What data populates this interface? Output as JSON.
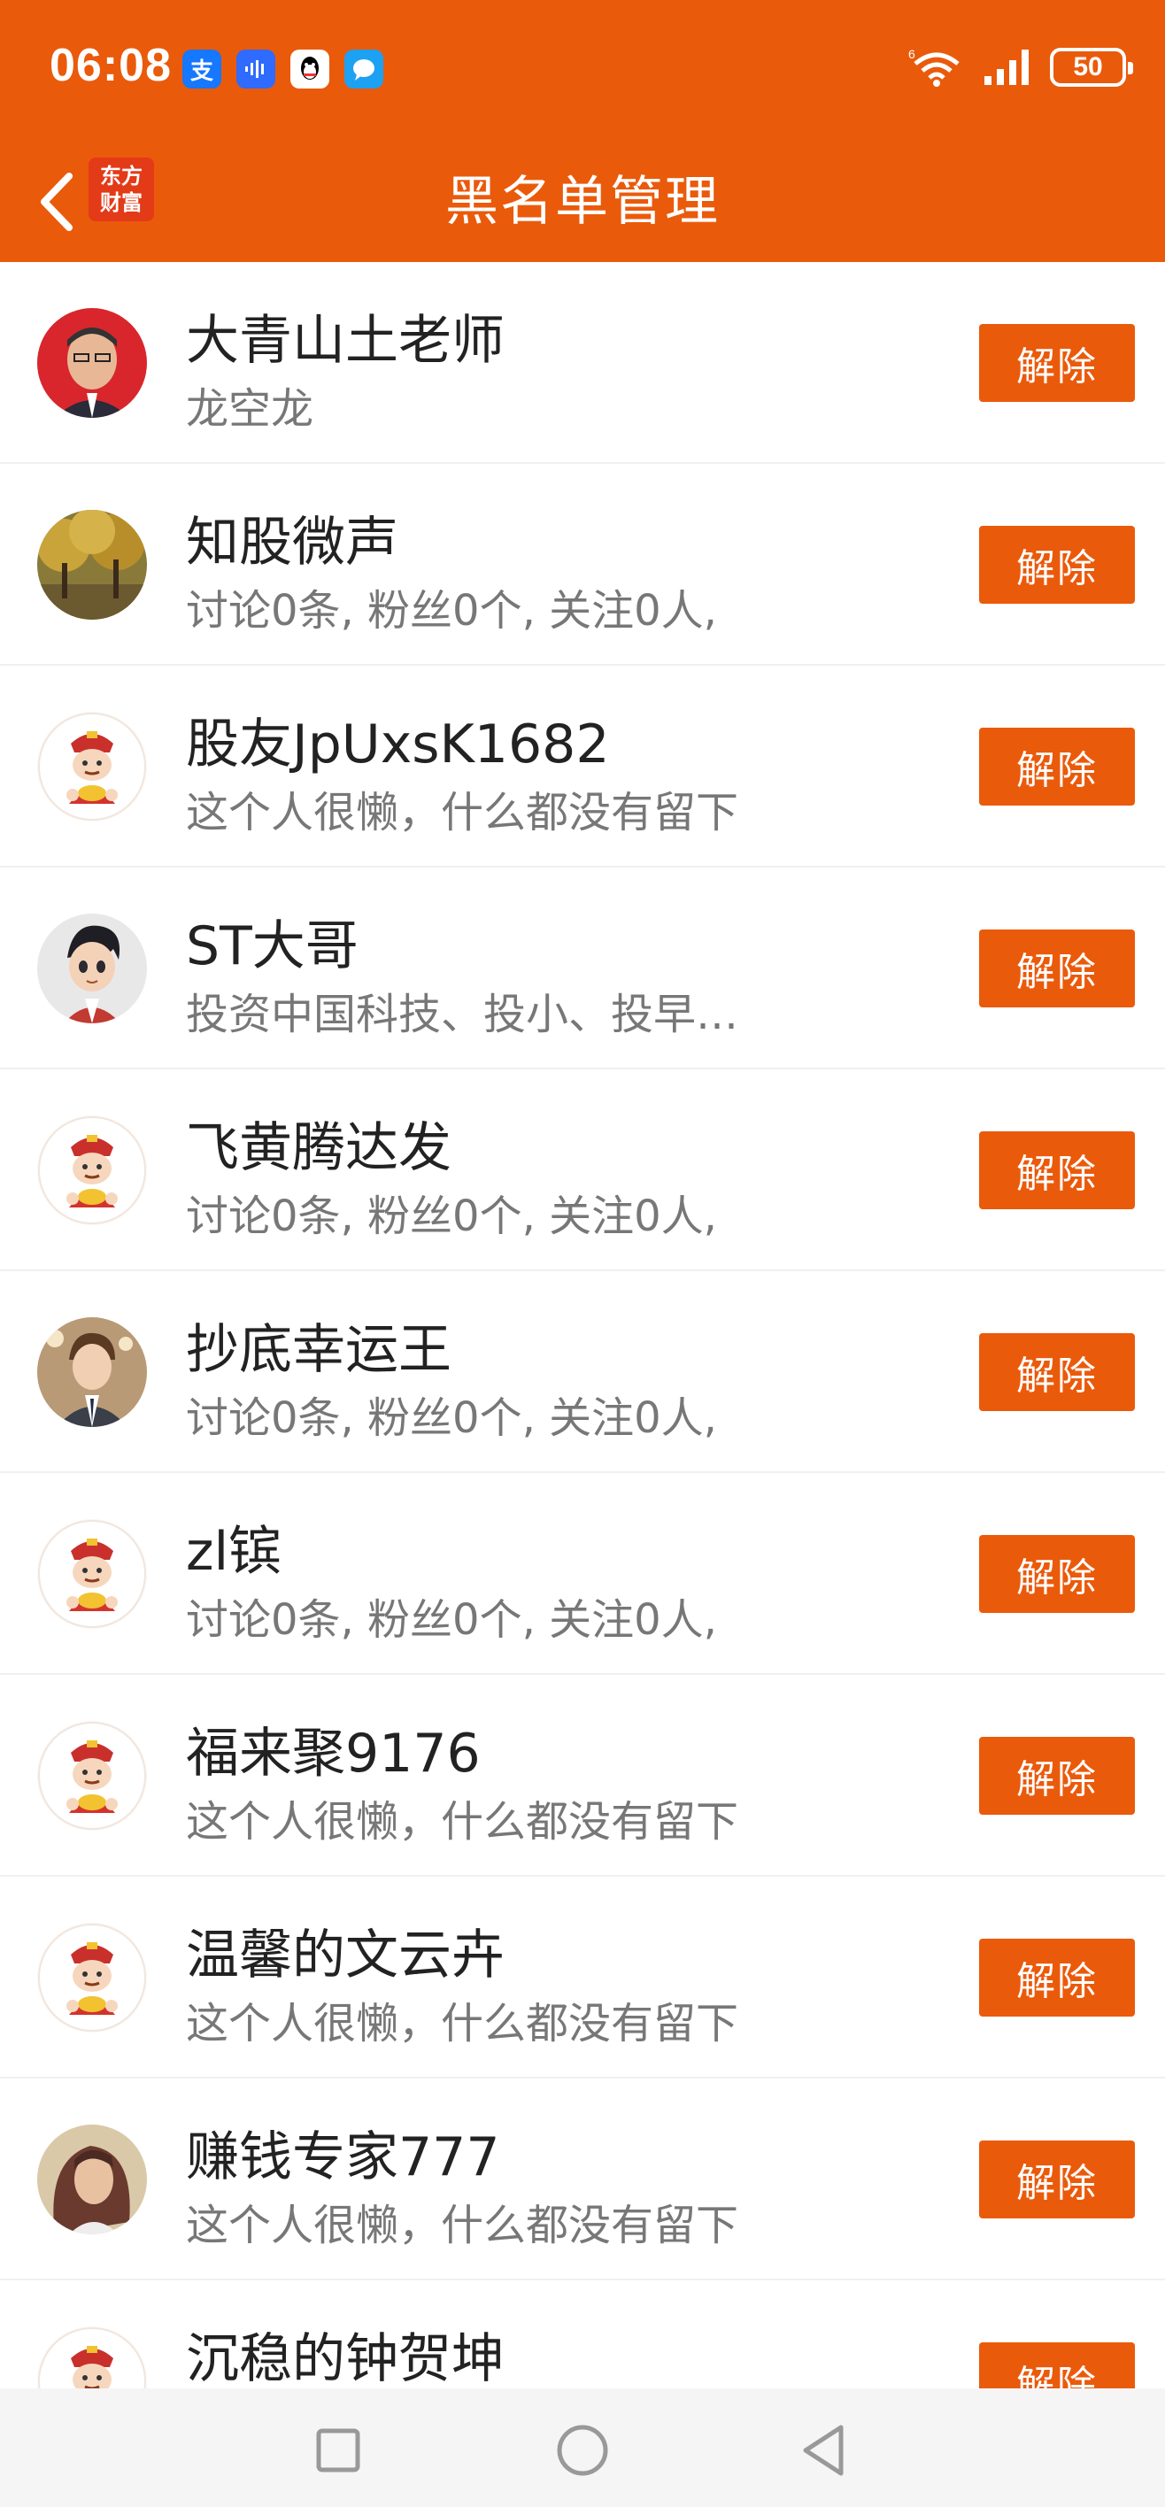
{
  "status_bar": {
    "time": "06:08",
    "battery": "50",
    "notification_icons": [
      "alipay-icon",
      "voice-icon",
      "qq-icon",
      "message-icon"
    ],
    "alipay_glyph": "支",
    "network_label": "6"
  },
  "title_bar": {
    "title": "黑名单管理",
    "logo_line1": "东方",
    "logo_line2": "财富"
  },
  "unblock_label": "解除",
  "users": [
    {
      "name": "大青山土老师",
      "desc": "龙空龙",
      "avatar": "photo-man"
    },
    {
      "name": "知股微声",
      "desc": "讨论0条, 粉丝0个, 关注0人,",
      "avatar": "photo-trees"
    },
    {
      "name": "股友JpUxsK1682",
      "desc": "这个人很懒，什么都没有留下",
      "avatar": "default-mascot"
    },
    {
      "name": "ST大哥",
      "desc": "投资中国科技、投小、投早…",
      "avatar": "cartoon-boy"
    },
    {
      "name": "飞黄腾达发",
      "desc": "讨论0条, 粉丝0个, 关注0人,",
      "avatar": "default-mascot"
    },
    {
      "name": "抄底幸运王",
      "desc": "讨论0条, 粉丝0个, 关注0人,",
      "avatar": "photo-suit-man"
    },
    {
      "name": "zl镔",
      "desc": "讨论0条, 粉丝0个, 关注0人,",
      "avatar": "default-mascot"
    },
    {
      "name": "福来聚9176",
      "desc": "这个人很懒，什么都没有留下",
      "avatar": "default-mascot"
    },
    {
      "name": "温馨的文云卉",
      "desc": "这个人很懒，什么都没有留下",
      "avatar": "default-mascot"
    },
    {
      "name": "赚钱专家777",
      "desc": "这个人很懒，什么都没有留下",
      "avatar": "photo-woman"
    },
    {
      "name": "沉稳的钟贺坤",
      "desc": "",
      "avatar": "default-mascot"
    }
  ],
  "colors": {
    "brand": "#ea5a0b",
    "name_text": "#222222",
    "desc_text": "#777777"
  },
  "nav_bar": [
    "recents-button",
    "home-button",
    "back-nav-button"
  ]
}
